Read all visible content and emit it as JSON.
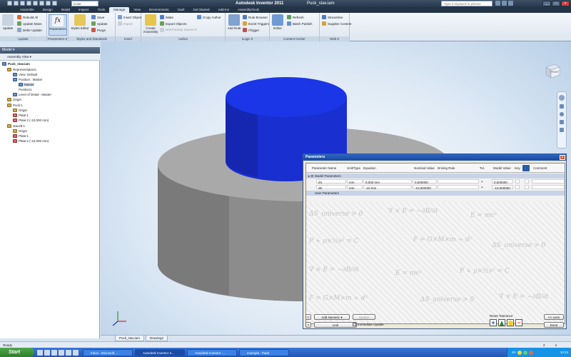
{
  "app": {
    "title": "Autodesk Inventor 2011",
    "document": "Puck_stav.iam",
    "style_value": "Color",
    "search_placeholder": "Type a keyword or phrase"
  },
  "tabs": [
    {
      "label": "Assemble"
    },
    {
      "label": "Design"
    },
    {
      "label": "Model"
    },
    {
      "label": "Inspect"
    },
    {
      "label": "Tools"
    },
    {
      "label": "Manage",
      "active": true
    },
    {
      "label": "View"
    },
    {
      "label": "Environments"
    },
    {
      "label": "Vault"
    },
    {
      "label": "Get Started"
    },
    {
      "label": "Add-Ins"
    },
    {
      "label": "AssemblyTools"
    }
  ],
  "ribbon": {
    "update": {
      "label": "Update",
      "rebuild_all": "Rebuild All",
      "update_mass": "Update Mass",
      "defer_update": "Defer Update",
      "panel": "Update"
    },
    "parameters": {
      "label": "Parameters",
      "panel": "Parameters ▾"
    },
    "styles": {
      "styles_editor": "Styles Editor",
      "save": "Save",
      "update": "Update",
      "purge": "Purge",
      "panel": "Styles and Standards"
    },
    "insert": {
      "insert_object": "Insert Object",
      "import": "Import",
      "panel": "Insert"
    },
    "author": {
      "create_assembly": "Create iAssembly",
      "imate": "iMate",
      "export_objects": "Export Objects",
      "unit_factory": "Unit Factory Source ▾",
      "icopy_author": "iCopy Author",
      "panel": "Author"
    },
    "ilogic": {
      "add_rule": "Add Rule",
      "rule_browser": "Rule Browser",
      "event_triggers": "Event Triggers",
      "itrigger": "iTrigger",
      "panel": "iLogic ▾"
    },
    "content_center": {
      "editor": "Editor",
      "refresh": "Refresh",
      "batch_publish": "Batch Publish",
      "panel": "Content Center"
    },
    "web": {
      "streamline": "Streamline",
      "supplier_content": "Supplier Content",
      "panel": "Web ▾"
    }
  },
  "browser": {
    "header": "Model ▾",
    "toolbar": "Assembly View ▾",
    "nodes": [
      {
        "label": "Puck_stav.iam",
        "bold": true
      },
      {
        "label": "Representations"
      },
      {
        "label": "View: Default"
      },
      {
        "label": "Position : Master"
      },
      {
        "label": "Master",
        "selected": true
      },
      {
        "label": "Position1"
      },
      {
        "label": "Level of Detail : Master"
      },
      {
        "label": "Origin"
      },
      {
        "label": "Puck:1"
      },
      {
        "label": "Origin"
      },
      {
        "label": "Plate:1"
      },
      {
        "label": "Plate:2 (-10,000 mm)"
      },
      {
        "label": "stav28:1"
      },
      {
        "label": "Origin"
      },
      {
        "label": "Plate:1"
      },
      {
        "label": "Plate:2 (-10,000 mm)"
      }
    ]
  },
  "viewcube": {
    "label": "FRONT"
  },
  "doc_tabs": [
    {
      "label": "Puck_stav.iam"
    },
    {
      "label": "Drawing2"
    }
  ],
  "status": {
    "text": "Ready",
    "n1": "2",
    "n2": "4"
  },
  "taskbar": {
    "start": "Start",
    "tasks": [
      {
        "label": "Inbox - Microsoft ..."
      },
      {
        "label": "Autodesk Inventor 2...",
        "active": true
      },
      {
        "label": "Autodesk Inventor -..."
      },
      {
        "label": "example - Paint"
      }
    ],
    "lang": "SV",
    "clock": "10:23"
  },
  "parameters_dialog": {
    "title": "Parameters",
    "headers": {
      "name": "Parameter Name",
      "unit": "Unit/Type",
      "equation": "Equation",
      "nominal": "Nominal Value",
      "driving": "Driving Rule",
      "tol": "Tol.",
      "model": "Model Value",
      "key": "Key",
      "comment": "Comment"
    },
    "group_model": "Model Parameters",
    "group_user": "User Parameters",
    "rows": [
      {
        "name": "d4",
        "unit": "mm",
        "equation": "0,000 mm",
        "nominal": "0,000000",
        "model": "0,000000"
      },
      {
        "name": "d5",
        "unit": "mm",
        "equation": "-10 mm",
        "nominal": "-10,000000",
        "model": "-10,000000"
      }
    ],
    "formulas": [
      "ΔS_universe > 0",
      "∇ × E = −∂B/∂t",
      "E = mc²",
      "P + ρ×½v² = C",
      "F = G×M×m ÷ d²",
      "ΔS_universe > 0",
      "∇ × E = −∂B/∂t",
      "E = mc²",
      "P + ρ×½v² = C",
      "F = G×M×m ÷ d²",
      "ΔS_universe > 0",
      "∇ × E = −∂B/∂t"
    ],
    "add_numeric": "Add Numeric",
    "update": "Update",
    "link": "Link",
    "immediate_update": "Immediate Update",
    "reset_tolerance": "Reset Tolerance",
    "less": "<< Less",
    "done": "Done",
    "colors": {
      "plus": "#1c49b7",
      "triangle": "#1f8b2a",
      "circle": "#f2cf1a",
      "minus": "#c83232"
    }
  },
  "model_colors": {
    "body": "#a9a9a9",
    "top": "#1a2fd0"
  }
}
